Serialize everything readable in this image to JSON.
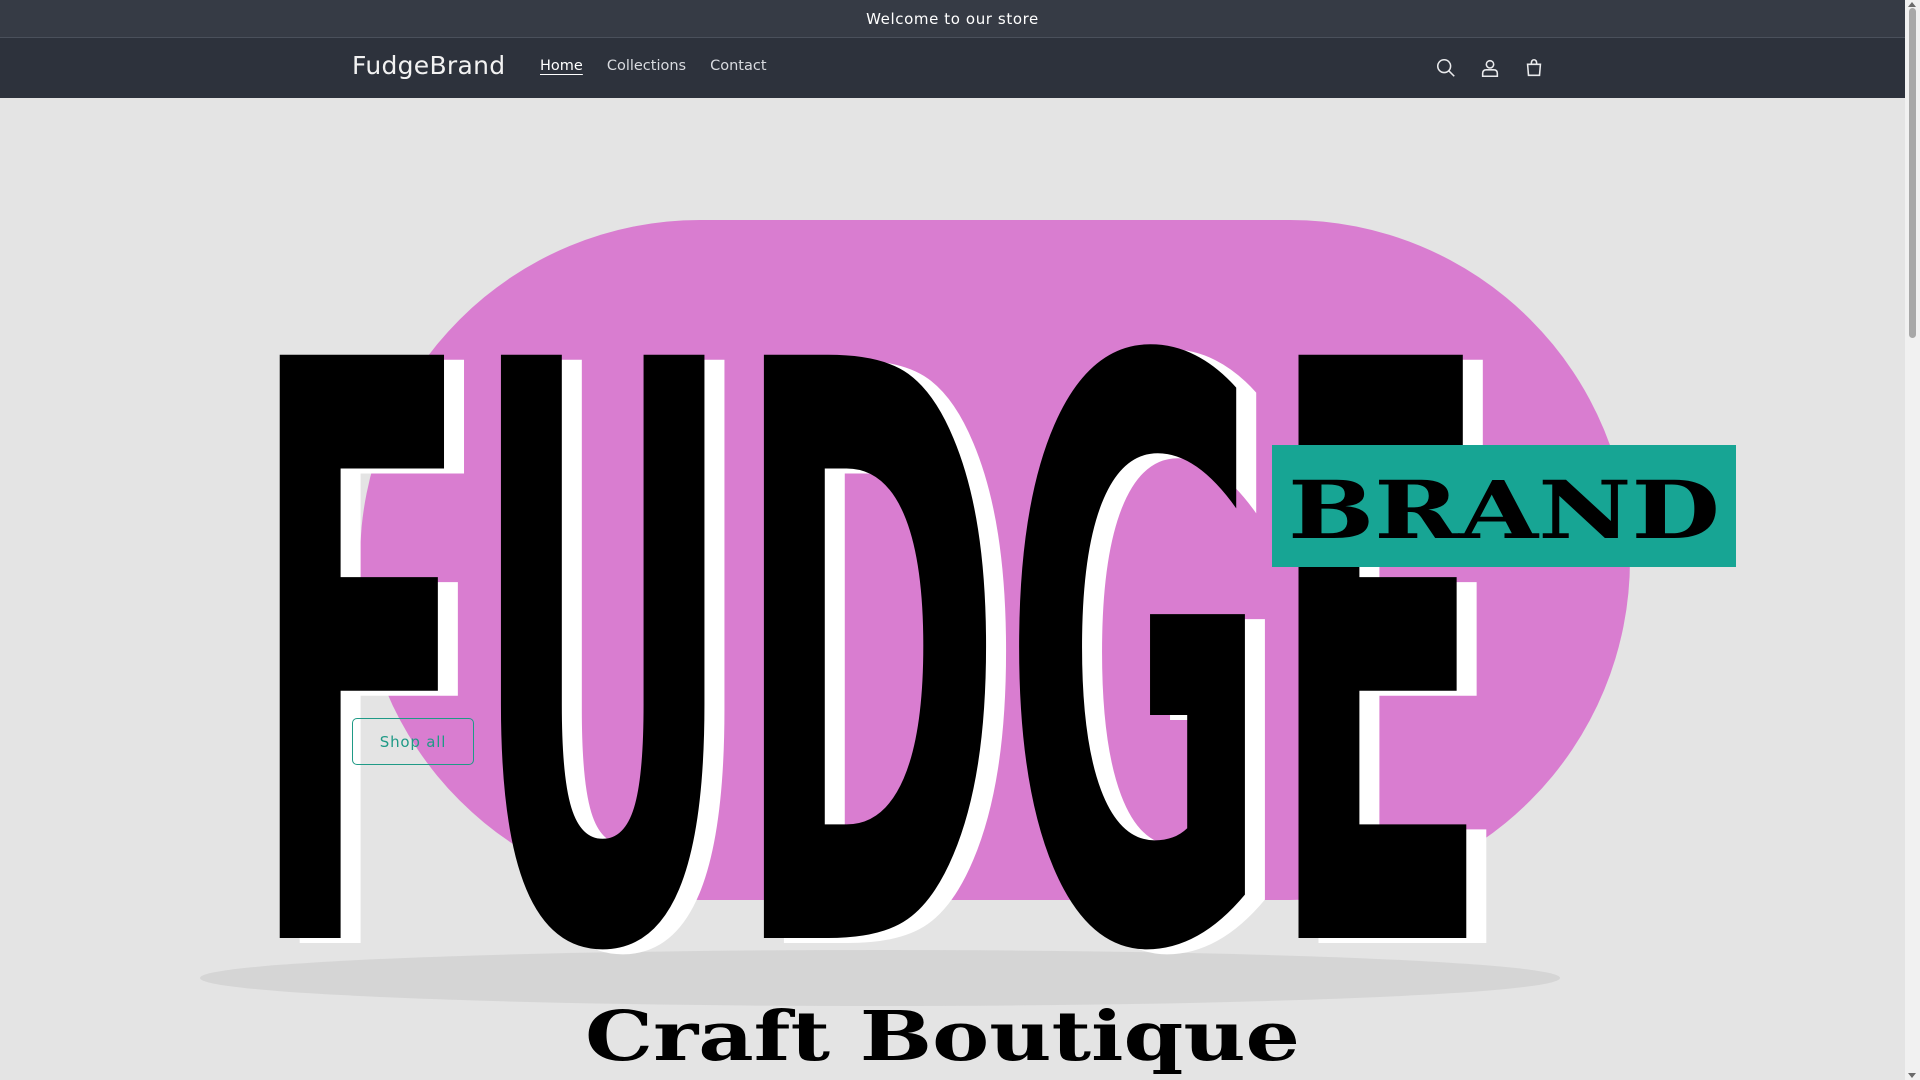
{
  "announcement": {
    "text": "Welcome to our store"
  },
  "header": {
    "brand": "FudgeBrand",
    "nav": [
      {
        "label": "Home",
        "active": true
      },
      {
        "label": "Collections",
        "active": false
      },
      {
        "label": "Contact",
        "active": false
      }
    ],
    "icons": [
      "search-icon",
      "account-icon",
      "cart-icon"
    ]
  },
  "hero": {
    "logo_main": "FUDGE",
    "logo_badge": "BRAND",
    "logo_tagline": "Craft Boutique",
    "cta_label": "Shop all"
  },
  "colors": {
    "announcement_bg": "#363b45",
    "header_bg": "#2d323c",
    "hero_bg": "#e4e4e4",
    "pill_pink": "#d97dd0",
    "badge_teal": "#17a594",
    "accent": "#1f9a86"
  }
}
